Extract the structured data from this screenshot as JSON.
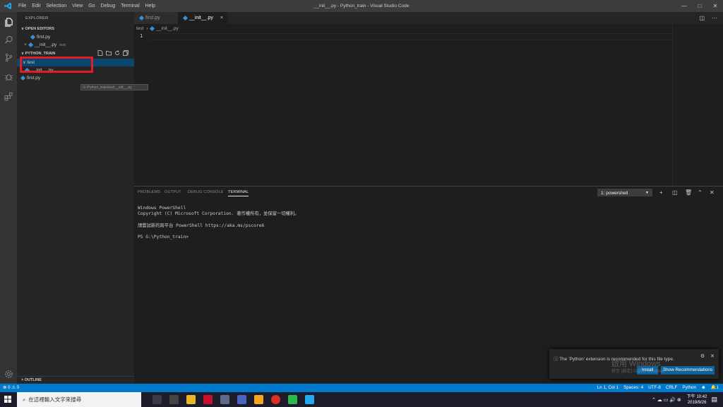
{
  "window": {
    "title": "__init__.py - Python_train - Visual Studio Code",
    "menu": [
      "File",
      "Edit",
      "Selection",
      "View",
      "Go",
      "Debug",
      "Terminal",
      "Help"
    ],
    "controls": [
      "—",
      "□",
      "✕"
    ]
  },
  "sidebar": {
    "title": "EXPLORER",
    "open_editors": {
      "header": "∨ OPEN EDITORS",
      "items": [
        {
          "name": "first.py",
          "folder": ""
        },
        {
          "name": "__init__.py",
          "folder": "test",
          "close": "×"
        }
      ]
    },
    "project": {
      "header": "∨ PYTHON_TRAIN",
      "folder": "∨ test",
      "items": [
        {
          "name": "__init__.py"
        },
        {
          "name": "first.py"
        }
      ]
    },
    "tooltip": "G:\\Python_train\\test\\__init__.py",
    "outline": "> OUTLINE"
  },
  "tabs": [
    {
      "label": "first.py",
      "active": false
    },
    {
      "label": "__init__.py",
      "active": true,
      "close": "×"
    }
  ],
  "breadcrumb": {
    "folder": "test",
    "separator": "›",
    "file": "__init__.py"
  },
  "editor": {
    "line_number": "1"
  },
  "panel": {
    "tabs": [
      "PROBLEMS",
      "OUTPUT",
      "DEBUG CONSOLE",
      "TERMINAL"
    ],
    "active_tab": "TERMINAL",
    "terminal_select": "1: powershell",
    "terminal_lines": [
      "Windows PowerShell",
      "Copyright (C) Microsoft Corporation. 著作權所有，並保留一切權利。",
      "",
      "請嘗試新的跨平台 PowerShell https://aka.ms/pscore6",
      "",
      "PS G:\\Python_train>"
    ]
  },
  "notification": {
    "message": "The 'Python' extension is recommended for this file type.",
    "install": "Install",
    "show": "Show Recommendations",
    "watermark": "啟用 Windows",
    "watermark_sub": "移至 [設定] 以啟用 Windows"
  },
  "statusbar": {
    "errors": "⊗ 0",
    "warnings": "⚠ 0",
    "position": "Ln 1, Col 1",
    "spaces": "Spaces: 4",
    "encoding": "UTF-8",
    "eol": "CRLF",
    "language": "Python",
    "bell": "1"
  },
  "taskbar": {
    "search_placeholder": "在這裡輸入文字來搜尋",
    "time": "下午 10:42",
    "date": "2019/9/26"
  }
}
